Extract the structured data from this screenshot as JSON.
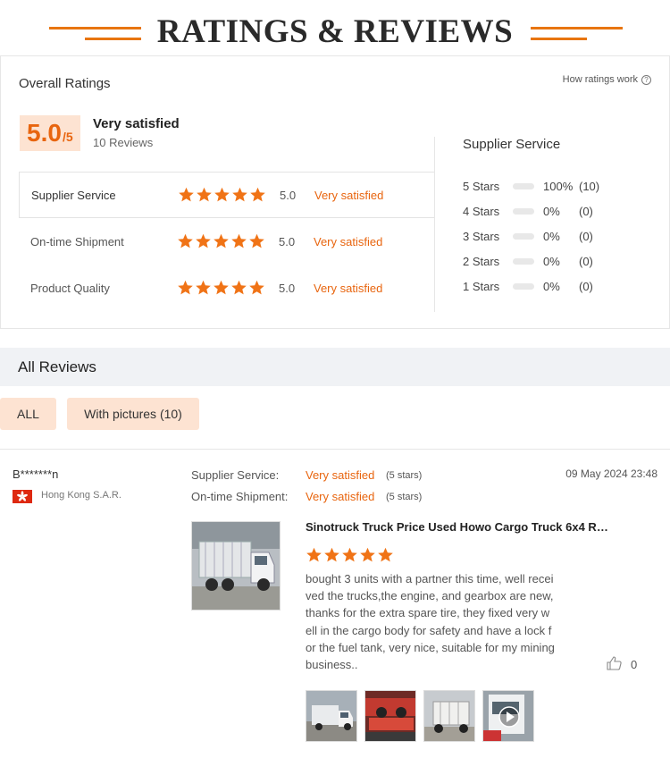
{
  "header": {
    "title": "RATINGS & REVIEWS"
  },
  "overall": {
    "title": "Overall Ratings",
    "how_link": "How ratings work",
    "score": "5.0",
    "score_max": "/5",
    "label": "Very satisfied",
    "review_count": "10 Reviews"
  },
  "categories": [
    {
      "label": "Supplier Service",
      "stars": 5,
      "score": "5.0",
      "verdict": "Very satisfied"
    },
    {
      "label": "On-time Shipment",
      "stars": 5,
      "score": "5.0",
      "verdict": "Very satisfied"
    },
    {
      "label": "Product Quality",
      "stars": 5,
      "score": "5.0",
      "verdict": "Very satisfied"
    }
  ],
  "distribution": {
    "title": "Supplier Service",
    "rows": [
      {
        "label": "5 Stars",
        "percent": "100%",
        "count": "(10)",
        "fraction": 1.0
      },
      {
        "label": "4 Stars",
        "percent": "0%",
        "count": "(0)",
        "fraction": 0
      },
      {
        "label": "3 Stars",
        "percent": "0%",
        "count": "(0)",
        "fraction": 0
      },
      {
        "label": "2 Stars",
        "percent": "0%",
        "count": "(0)",
        "fraction": 0
      },
      {
        "label": "1 Stars",
        "percent": "0%",
        "count": "(0)",
        "fraction": 0
      }
    ]
  },
  "all_reviews": {
    "title": "All Reviews",
    "filters": [
      "ALL",
      "With pictures (10)"
    ]
  },
  "review": {
    "reviewer": "B*******n",
    "country": "Hong Kong S.A.R.",
    "date": "09 May 2024 23:48",
    "meta": [
      {
        "label": "Supplier Service:",
        "value": "Very satisfied",
        "stars": "(5 stars)"
      },
      {
        "label": "On-time Shipment:",
        "value": "Very satisfied",
        "stars": "(5 stars)"
      }
    ],
    "product_title": "Sinotruck Truck Price Used Howo Cargo Truck 6x4 RH...",
    "rating": 5,
    "text": "bought 3 units with a partner this time, well received the trucks,the engine, and gearbox are new, thanks for the extra spare tire, they fixed very well in the cargo body for safety and have a lock for the fuel tank, very nice, suitable for my mining business..",
    "likes": "0",
    "thumbnail_count": 4
  },
  "colors": {
    "accent": "#e8650f",
    "badge_bg": "#fde3d2",
    "star": "#f07316"
  }
}
